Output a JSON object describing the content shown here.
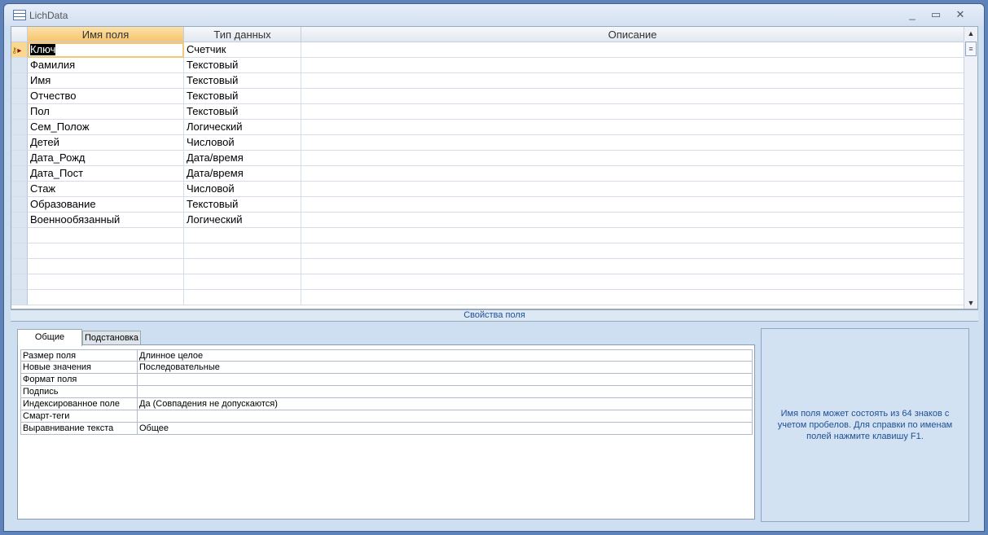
{
  "window": {
    "title": "LichData",
    "minimize": "_",
    "maximize": "▭",
    "close": "✕"
  },
  "grid": {
    "headers": [
      "Имя поля",
      "Тип данных",
      "Описание"
    ],
    "rows": [
      {
        "name": "Ключ",
        "type": "Счетчик"
      },
      {
        "name": "Фамилия",
        "type": "Текстовый"
      },
      {
        "name": "Имя",
        "type": "Текстовый"
      },
      {
        "name": "Отчество",
        "type": "Текстовый"
      },
      {
        "name": "Пол",
        "type": "Текстовый"
      },
      {
        "name": "Сем_Полож",
        "type": "Логический"
      },
      {
        "name": "Детей",
        "type": "Числовой"
      },
      {
        "name": "Дата_Рожд",
        "type": "Дата/время"
      },
      {
        "name": "Дата_Пост",
        "type": "Дата/время"
      },
      {
        "name": "Стаж",
        "type": "Числовой"
      },
      {
        "name": "Образование",
        "type": "Текстовый"
      },
      {
        "name": "Военнообязанный",
        "type": "Логический"
      }
    ],
    "empty_rows": 5
  },
  "properties": {
    "bar_label": "Свойства поля",
    "tabs": [
      "Общие",
      "Подстановка"
    ],
    "rows": [
      {
        "k": "Размер поля",
        "v": "Длинное целое"
      },
      {
        "k": "Новые значения",
        "v": "Последовательные"
      },
      {
        "k": "Формат поля",
        "v": ""
      },
      {
        "k": "Подпись",
        "v": ""
      },
      {
        "k": "Индексированное поле",
        "v": "Да (Совпадения не допускаются)"
      },
      {
        "k": "Смарт-теги",
        "v": ""
      },
      {
        "k": "Выравнивание текста",
        "v": "Общее"
      }
    ],
    "help": "Имя поля может состоять из 64 знаков с учетом пробелов.  Для справки по именам полей нажмите клавишу F1."
  }
}
